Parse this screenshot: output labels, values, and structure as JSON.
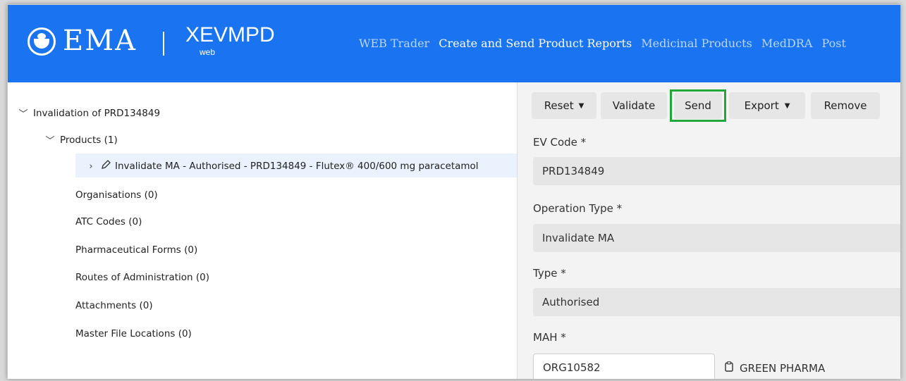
{
  "header": {
    "brand": "EMA",
    "product": "XEVMPD",
    "product_sub": "web",
    "nav": [
      {
        "label": "WEB Trader",
        "active": false
      },
      {
        "label": "Create and Send Product Reports",
        "active": true
      },
      {
        "label": "Medicinal Products",
        "active": false
      },
      {
        "label": "MedDRA",
        "active": false
      },
      {
        "label": "Post",
        "active": false
      }
    ]
  },
  "tree": {
    "root": "Invalidation of PRD134849",
    "products": "Products (1)",
    "product_item": "Invalidate MA - Authorised - PRD134849 - Flutex® 400/600 mg paracetamol",
    "organisations": "Organisations (0)",
    "atc_codes": "ATC Codes (0)",
    "pharm_forms": "Pharmaceutical Forms (0)",
    "routes": "Routes of Administration (0)",
    "attachments": "Attachments (0)",
    "master_files": "Master File Locations (0)"
  },
  "toolbar": {
    "reset": "Reset",
    "validate": "Validate",
    "send": "Send",
    "export": "Export",
    "remove": "Remove"
  },
  "form": {
    "ev_code_label": "EV Code *",
    "ev_code_value": "PRD134849",
    "operation_type_label": "Operation Type *",
    "operation_type_value": "Invalidate MA",
    "type_label": "Type *",
    "type_value": "Authorised",
    "mah_label": "MAH *",
    "mah_value": "ORG10582",
    "mah_name": "GREEN PHARMA"
  },
  "colors": {
    "header_bg": "#1a73f0",
    "highlight": "#22a83a",
    "selected_row": "#e9f2fd"
  }
}
